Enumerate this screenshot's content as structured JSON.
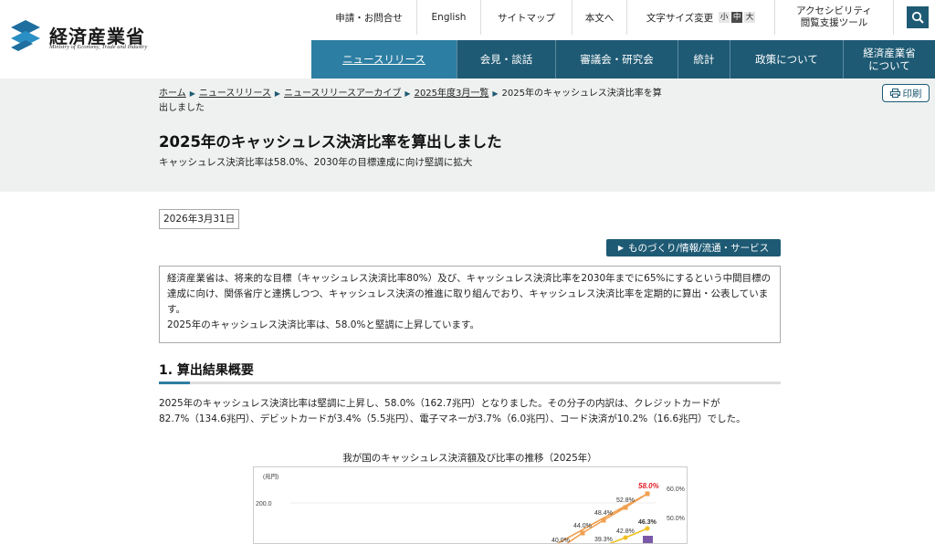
{
  "header": {
    "logo_text": "経済産業省",
    "logo_sub": "Ministry of Economy, Trade and Industry",
    "util_links": [
      "申請・お問合せ",
      "English",
      "サイトマップ",
      "本文へ"
    ],
    "fontsize_label": "文字サイズ変更",
    "fontsize_options": [
      "小",
      "中",
      "大"
    ],
    "fontsize_selected": "中",
    "accessibility_line1": "アクセシビリティ",
    "accessibility_line2": "閲覧支援ツール",
    "search_icon": "search-icon"
  },
  "nav": {
    "items": [
      "ニュースリリース",
      "会見・談話",
      "審議会・研究会",
      "統計",
      "政策について",
      "経済産業省",
      "について"
    ],
    "active": "ニュースリリース"
  },
  "breadcrumb": {
    "home": "ホーム",
    "news": "ニュースリリース",
    "archive": "ニュースリリースアーカイブ",
    "month": "2025年度3月一覧",
    "current": "2025年のキャッシュレス決済比率を算出しました"
  },
  "print_label": "印刷",
  "page": {
    "title": "2025年のキャッシュレス決済比率を算出しました",
    "subtitle": "キャッシュレス決済比率は58.0%、2030年の目標達成に向け堅調に拡大",
    "date": "2026年3月31日",
    "category": "ものづくり/情報/流通・サービス",
    "summary_p1": "経済産業省は、将来的な目標（キャッシュレス決済比率80%）及び、キャッシュレス決済比率を2030年までに65%にするという中間目標の達成に向け、関係省庁と連携しつつ、キャッシュレス決済の推進に取り組んでおり、キャッシュレス決済比率を定期的に算出・公表しています。",
    "summary_p2": "2025年のキャッシュレス決済比率は、58.0%と堅調に上昇しています。",
    "section_heading": "1. 算出結果概要",
    "section_text": "2025年のキャッシュレス決済比率は堅調に上昇し、58.0%（162.7兆円）となりました。その分子の内訳は、クレジットカードが82.7%（134.6兆円）、デビットカードが3.4%（5.5兆円）、電子マネーが3.7%（6.0兆円）、コード決済が10.2%（16.6兆円）でした。",
    "chart_title": "我が国のキャッシュレス決済額及び比率の推移（2025年）"
  },
  "chart_data": {
    "type": "line",
    "y_unit_label": "(兆円)",
    "y_tick_labels": [
      "200.0",
      "150.0"
    ],
    "right_tick_labels": [
      "60.0%",
      "50.0%"
    ],
    "series": [
      {
        "name": "",
        "color": "#f0a050",
        "labels": [
          "40.0%",
          "44.0%",
          "48.4%",
          "52.8%",
          "58.0%"
        ]
      },
      {
        "name": "",
        "color": "#f0c020",
        "labels": [
          "39.3%",
          "42.8%",
          "46.3%"
        ]
      }
    ],
    "highlight_label": "58.0%",
    "highlight_color": "#e0202a",
    "bar_color": "#7a5aa8"
  }
}
